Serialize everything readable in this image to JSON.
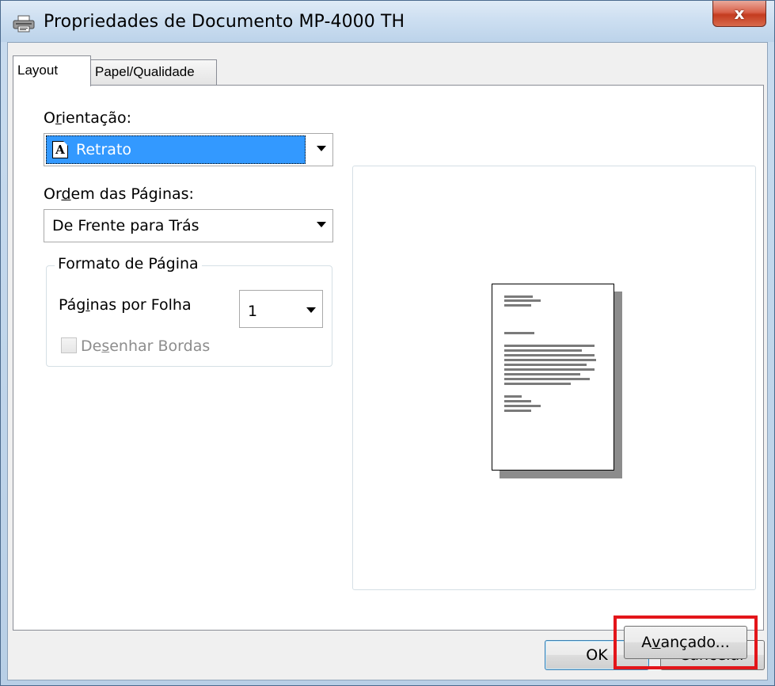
{
  "window": {
    "title": "Propriedades de Documento MP-4000 TH",
    "title_icon": "printer-icon",
    "close_label": "x"
  },
  "tabs": [
    {
      "label": "Layout",
      "active": true
    },
    {
      "label": "Papel/Qualidade",
      "active": false
    }
  ],
  "layout": {
    "orientation": {
      "label_pre": "O",
      "label_u": "r",
      "label_post": "ientação:",
      "value": "Retrato",
      "icon": "portrait-page-icon"
    },
    "page_order": {
      "label_pre": "Or",
      "label_u": "d",
      "label_post": "em das Páginas:",
      "value": "De Frente para Trás"
    },
    "page_format": {
      "caption": "Formato de Página",
      "pages_per_sheet": {
        "label_pre": "Pág",
        "label_u": "i",
        "label_post": "nas por Folha",
        "value": "1"
      },
      "draw_borders": {
        "label_pre": "De",
        "label_u": "s",
        "label_post": "enhar Bordas",
        "checked": false,
        "disabled": true
      }
    },
    "advanced_button": {
      "label_pre": "A",
      "label_u": "v",
      "label_post": "ançado..."
    }
  },
  "footer": {
    "ok_label": "OK",
    "cancel_label": "Cancelar"
  },
  "colors": {
    "selection": "#3399ff",
    "highlight_box": "#e3151a",
    "close_button": "#c43b1f"
  }
}
